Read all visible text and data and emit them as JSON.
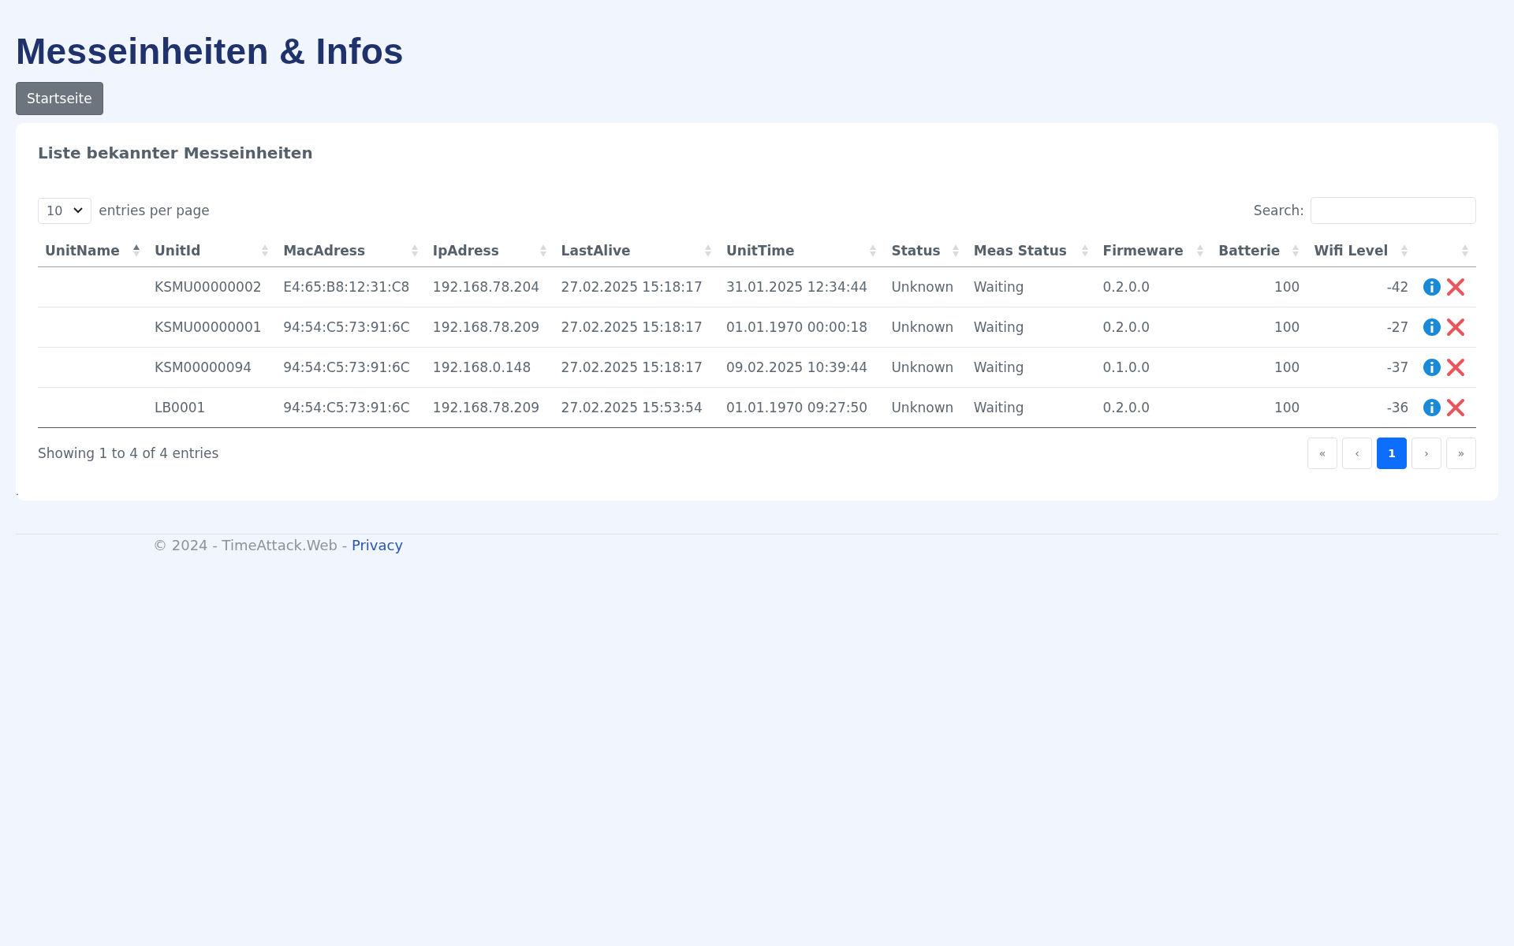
{
  "page_title": "Messeinheiten & Infos",
  "home_button": "Startseite",
  "card": {
    "title": "Liste bekannter Messeinheiten",
    "page_size": "10",
    "page_size_label": "entries per page",
    "search_label": "Search:",
    "columns": [
      {
        "label": "UnitName",
        "sorted": true,
        "numeric": false
      },
      {
        "label": "UnitId",
        "sorted": false,
        "numeric": false
      },
      {
        "label": "MacAdress",
        "sorted": false,
        "numeric": false
      },
      {
        "label": "IpAdress",
        "sorted": false,
        "numeric": false
      },
      {
        "label": "LastAlive",
        "sorted": false,
        "numeric": false
      },
      {
        "label": "UnitTime",
        "sorted": false,
        "numeric": false
      },
      {
        "label": "Status",
        "sorted": false,
        "numeric": false
      },
      {
        "label": "Meas Status",
        "sorted": false,
        "numeric": false
      },
      {
        "label": "Firmeware",
        "sorted": false,
        "numeric": false
      },
      {
        "label": "Batterie",
        "sorted": false,
        "numeric": true
      },
      {
        "label": "Wifi Level",
        "sorted": false,
        "numeric": true
      },
      {
        "sorted": false
      }
    ],
    "rows": [
      {
        "cells": [
          "",
          "KSMU00000002",
          "E4:65:B8:12:31:C8",
          "192.168.78.204",
          "27.02.2025 15:18:17",
          "31.01.2025 12:34:44",
          "Unknown",
          "Waiting",
          "0.2.0.0",
          "100",
          "-42"
        ]
      },
      {
        "cells": [
          "",
          "KSMU00000001",
          "94:54:C5:73:91:6C",
          "192.168.78.209",
          "27.02.2025 15:18:17",
          "01.01.1970 00:00:18",
          "Unknown",
          "Waiting",
          "0.2.0.0",
          "100",
          "-27"
        ]
      },
      {
        "cells": [
          "",
          "KSM00000094",
          "94:54:C5:73:91:6C",
          "192.168.0.148",
          "27.02.2025 15:18:17",
          "09.02.2025 10:39:44",
          "Unknown",
          "Waiting",
          "0.1.0.0",
          "100",
          "-37"
        ]
      },
      {
        "cells": [
          "",
          "LB0001",
          "94:54:C5:73:91:6C",
          "192.168.78.209",
          "27.02.2025 15:53:54",
          "01.01.1970 09:27:50",
          "Unknown",
          "Waiting",
          "0.2.0.0",
          "100",
          "-36"
        ]
      }
    ],
    "info": "Showing 1 to 4 of 4 entries",
    "pagination": [
      {
        "label": "«",
        "selected": false
      },
      {
        "label": "‹",
        "selected": false
      },
      {
        "label": "1",
        "selected": true
      },
      {
        "label": "›",
        "selected": false
      },
      {
        "label": "»",
        "selected": false
      }
    ]
  },
  "stray_mark": ".",
  "footer": {
    "text": "© 2024 - TimeAttack.Web -",
    "link": "Privacy"
  }
}
